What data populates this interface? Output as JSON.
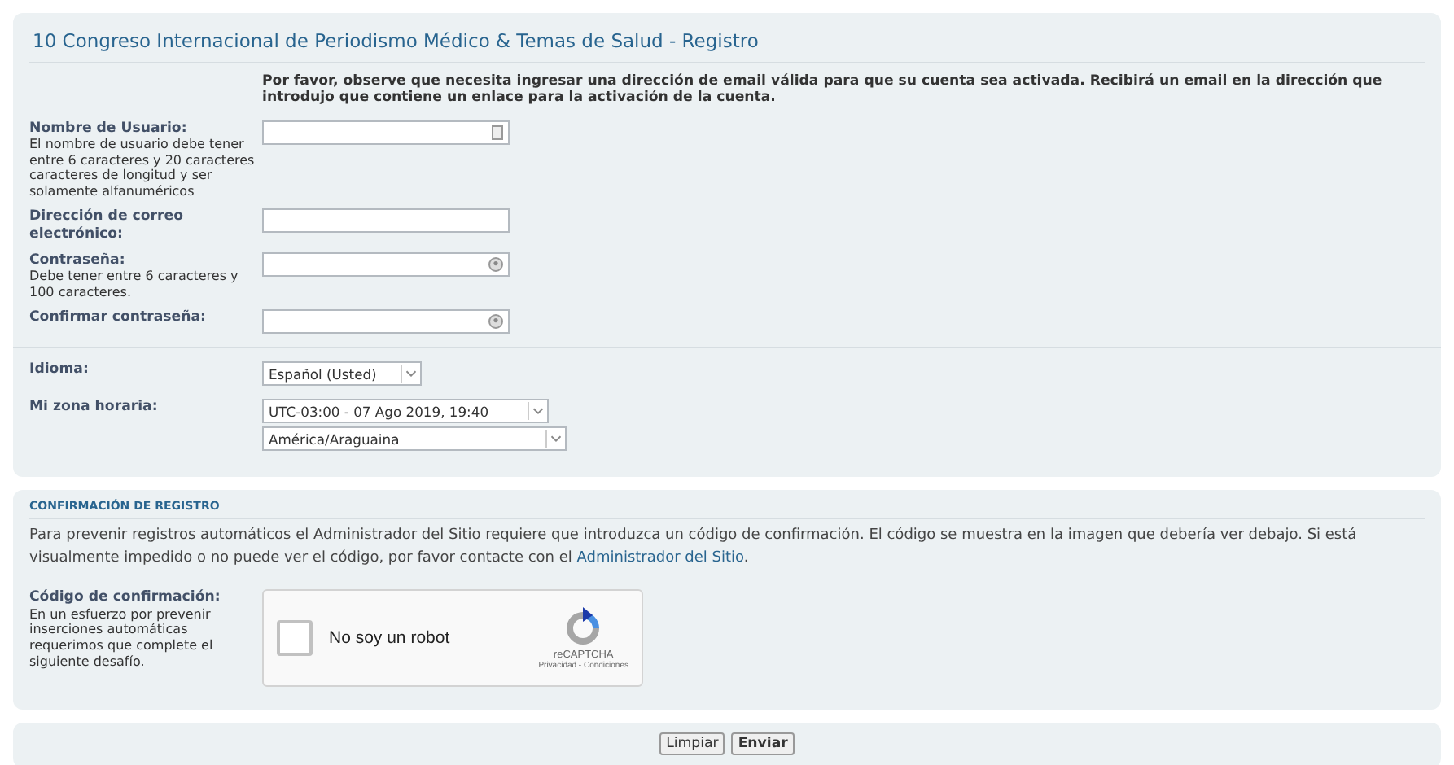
{
  "title": "10 Congreso Internacional de Periodismo Médico & Temas de Salud - Registro",
  "notice": "Por favor, observe que necesita ingresar una dirección de email válida para que su cuenta sea activada. Recibirá un email en la dirección que introdujo que contiene un enlace para la activación de la cuenta.",
  "account_fields": [
    {
      "label": "Nombre de Usuario:",
      "hint": "El nombre de usuario debe tener entre 6 caracteres y 20 caracteres caracteres de longitud y ser solamente alfanuméricos",
      "kind": "text-icon"
    },
    {
      "label": "Dirección de correo electrónico:",
      "kind": "text"
    },
    {
      "label": "Contraseña:",
      "hint": "Debe tener entre 6 caracteres y 100 caracteres.",
      "kind": "password"
    },
    {
      "label": "Confirmar contraseña:",
      "kind": "password"
    }
  ],
  "preferences": [
    {
      "label": "Idioma:",
      "selects": [
        {
          "value": "Español (Usted)"
        }
      ]
    },
    {
      "label": "Mi zona horaria:",
      "selects": [
        {
          "value": "UTC-03:00 - 07 Ago 2019, 19:40"
        },
        {
          "value": "América/Araguaina"
        }
      ]
    }
  ],
  "confirmation": {
    "heading": "CONFIRMACIÓN DE REGISTRO",
    "text": "Para prevenir registros automáticos el Administrador del Sitio requiere que introduzca un código de confirmación. El código se muestra en la imagen que debería ver debajo. Si está visualmente impedido o no puede ver el código, por favor contacte con el ",
    "link": "Administrador del Sitio",
    "text_end": ".",
    "label": "Código de confirmación:",
    "hint": "En un esfuerzo por prevenir inserciones automáticas requerimos que complete el siguiente desafío.",
    "captcha": {
      "checked": false,
      "label": "No soy un robot",
      "brand": "reCAPTCHA",
      "terms": "Privacidad - Condiciones"
    }
  },
  "buttons": [
    "Limpiar",
    "Enviar"
  ]
}
